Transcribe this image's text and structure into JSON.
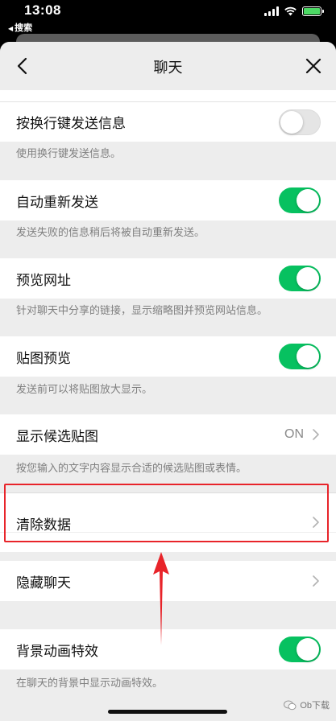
{
  "status_bar": {
    "time": "13:08",
    "back_label": "搜索"
  },
  "nav": {
    "title": "聊天"
  },
  "settings": {
    "enter_to_send": {
      "label": "按换行键发送信息",
      "description": "使用换行键发送信息。",
      "enabled": false
    },
    "auto_resend": {
      "label": "自动重新发送",
      "description": "发送失败的信息稍后将被自动重新发送。",
      "enabled": true
    },
    "preview_url": {
      "label": "预览网址",
      "description": "针对聊天中分享的链接，显示缩略图并预览网站信息。",
      "enabled": true
    },
    "sticker_preview": {
      "label": "贴图预览",
      "description": "发送前可以将贴图放大显示。",
      "enabled": true
    },
    "suggest_stickers": {
      "label": "显示候选贴图",
      "value": "ON",
      "description": "按您输入的文字内容显示合适的候选贴图或表情。"
    },
    "clear_data": {
      "label": "清除数据"
    },
    "hidden_chats": {
      "label": "隐藏聊天"
    },
    "background_effects": {
      "label": "背景动画特效",
      "description": "在聊天的背景中显示动画特效。",
      "enabled": true
    }
  },
  "colors": {
    "toggle_on": "#07c160",
    "highlight": "#e8242a"
  },
  "watermark": {
    "text": "Ob下载"
  }
}
